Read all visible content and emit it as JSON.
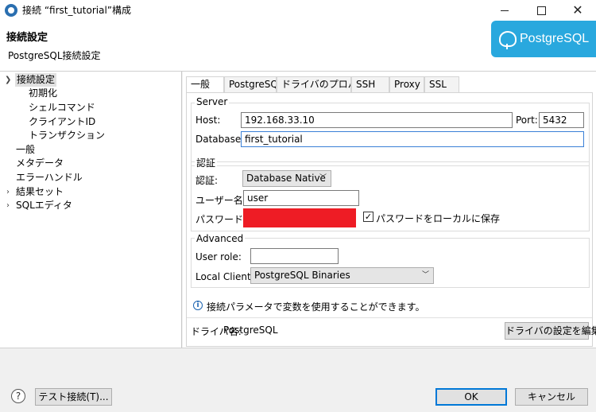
{
  "window": {
    "title": "接続 “first_tutorial”構成",
    "minimize_icon": "minimize-icon",
    "maximize_icon": "maximize-icon",
    "close_icon": "close-icon"
  },
  "header": {
    "title": "接続設定",
    "subtitle": "PostgreSQL接続設定",
    "logo_text": "PostgreSQL",
    "logo_color": "#29a8de"
  },
  "tree": {
    "items": [
      {
        "label": "接続設定",
        "expanded": true,
        "selected": true
      },
      {
        "label": "初期化"
      },
      {
        "label": "シェルコマンド"
      },
      {
        "label": "クライアントID"
      },
      {
        "label": "トランザクション"
      },
      {
        "label": "一般"
      },
      {
        "label": "メタデータ"
      },
      {
        "label": "エラーハンドル"
      },
      {
        "label": "結果セット",
        "expandable": true
      },
      {
        "label": "SQLエディタ",
        "expandable": true
      }
    ]
  },
  "tabs": [
    "一般",
    "PostgreSQL",
    "ドライバのプロパティ",
    "SSH",
    "Proxy",
    "SSL"
  ],
  "server": {
    "group_title": "Server",
    "host_label": "Host:",
    "host_value": "192.168.33.10",
    "port_label": "Port:",
    "port_value": "5432",
    "database_label": "Database:",
    "database_value": "first_tutorial"
  },
  "auth": {
    "group_title": "認証",
    "auth_label": "認証:",
    "auth_value": "Database Native",
    "user_label": "ユーザー名：",
    "user_value": "user",
    "password_label": "パスワード：",
    "save_password_label": "パスワードをローカルに保存",
    "save_password_checked": true,
    "redaction_color": "#ee1c25"
  },
  "advanced": {
    "group_title": "Advanced",
    "user_role_label": "User role:",
    "user_role_value": "",
    "local_client_label": "Local Client:",
    "local_client_value": "PostgreSQL Binaries"
  },
  "info": {
    "text": "接続パラメータで変数を使用することができます。"
  },
  "driver": {
    "label": "ドライバ名:",
    "name": "PostgreSQL",
    "edit_button": "ドライバの設定を編集"
  },
  "footer": {
    "help_icon": "?",
    "test_button": "テスト接続(T)...",
    "ok_button": "OK",
    "cancel_button": "キャンセル"
  }
}
